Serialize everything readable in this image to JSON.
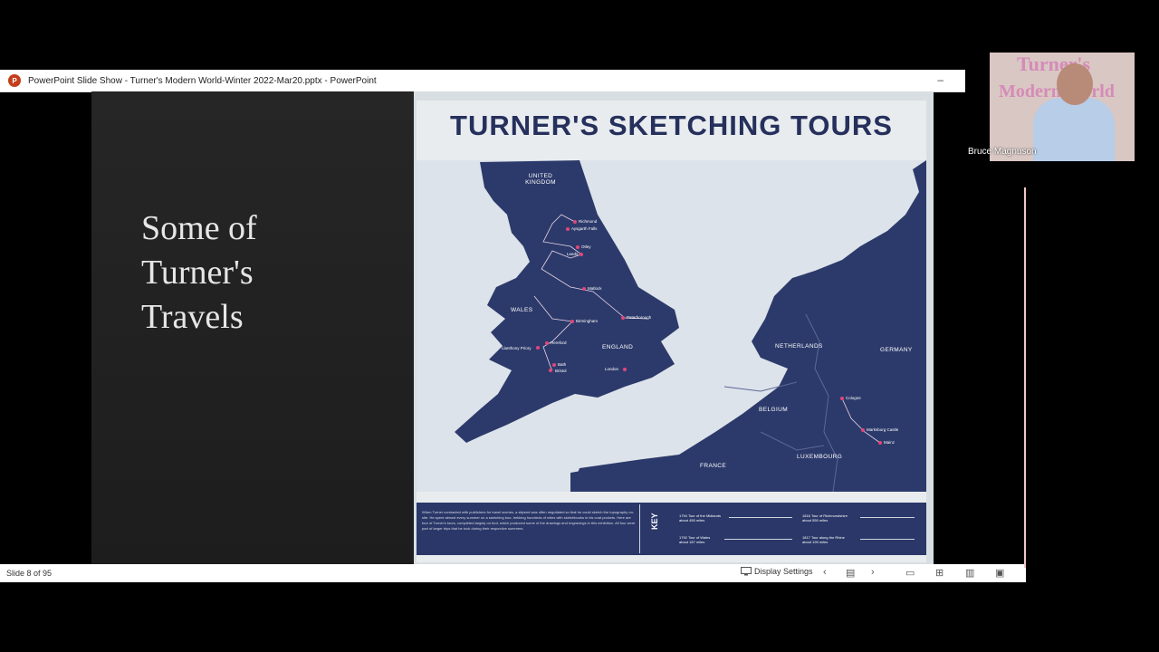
{
  "window": {
    "title": "PowerPoint Slide Show  -  Turner's Modern World-Winter 2022-Mar20.pptx - PowerPoint",
    "minimize": "–"
  },
  "slide": {
    "title_lines": [
      "Some of",
      "Turner's",
      "Travels"
    ]
  },
  "poster": {
    "title": "TURNER'S SKETCHING TOURS",
    "regions": {
      "uk": "UNITED KINGDOM",
      "wales": "WALES",
      "england": "ENGLAND",
      "netherlands": "NETHERLANDS",
      "germany": "GERMANY",
      "belgium": "BELGIUM",
      "france": "FRANCE",
      "luxembourg": "LUXEMBOURG"
    },
    "places": [
      "Richmond",
      "Aysgarth Falls",
      "Otley",
      "Leeds",
      "Matlock",
      "Birmingham",
      "Peterborough",
      "Hereford",
      "Llanthony Priory",
      "Bristol",
      "Bath",
      "London",
      "Cologne",
      "Marksburg Castle",
      "Mainz"
    ],
    "key_label": "KEY",
    "key_description": "When Turner contracted with publishers for travel scenes, a stipend was often negotiated so that he could sketch the topography on-site. He spent almost every summer on a sketching tour, trekking hundreds of miles with sketchbooks in his coat pockets. Here are four of Turner's tours, completed largely on foot, which produced some of the drawings and engravings in this exhibition. All four were part of larger trips that he took during their respective summers.",
    "tours": [
      {
        "name": "1794 Tour of the Midlands",
        "distance": "about 450 miles"
      },
      {
        "name": "1816 Tour of Richmondshire",
        "distance": "about 550 miles"
      },
      {
        "name": "1792 Tour of Wales",
        "distance": "about 187 miles"
      },
      {
        "name": "1817 Tour along the Rhine",
        "distance": "about 190 miles"
      }
    ]
  },
  "statusbar": {
    "slide_number": "Slide 8 of 95",
    "display_settings": "Display Settings"
  },
  "webcam": {
    "name": "Bruce Magnuson",
    "bg_text_1": "Turner's",
    "bg_text_2": "Modern World"
  },
  "colors": {
    "map_land": "#2c3a6b",
    "map_sea": "#dde3ea",
    "route_pink": "#e2467a",
    "slide_bg": "#222222"
  }
}
